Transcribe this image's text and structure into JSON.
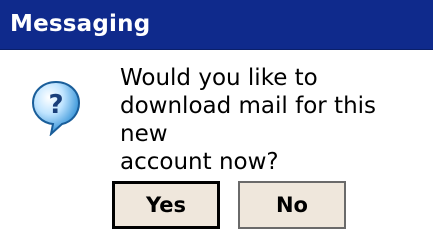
{
  "window": {
    "title": "Messaging"
  },
  "dialog": {
    "icon": "question-icon",
    "message": "Would you like to\ndownload mail for this new\naccount now?",
    "buttons": {
      "yes": "Yes",
      "no": "No"
    }
  },
  "colors": {
    "titlebar": "#0f2a8c",
    "title_text": "#ffffff",
    "button_face": "#efe7dc",
    "icon_fill": "#2e8fd6"
  }
}
